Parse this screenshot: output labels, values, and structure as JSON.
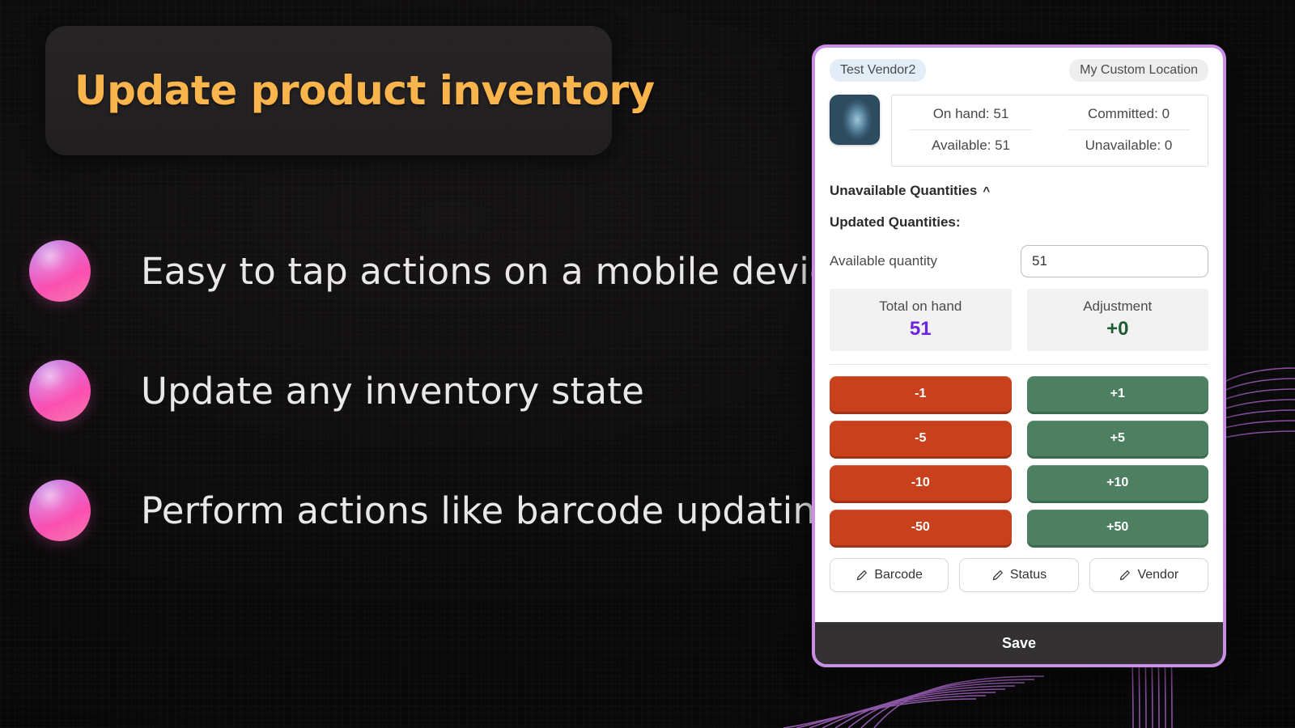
{
  "slide": {
    "title": "Update product inventory",
    "title_color": "#f9b44c",
    "bullets": [
      {
        "label": "Easy to tap actions on a mobile device",
        "marker": "gradient-sphere"
      },
      {
        "label": "Update any inventory state",
        "marker": "gradient-sphere"
      },
      {
        "label": "Perform actions like barcode updating",
        "marker": "gradient-sphere"
      }
    ]
  },
  "phone": {
    "frame_color": "#c98fe8",
    "vendor_pill": "Test Vendor2",
    "location_pill": "My Custom Location",
    "product_image": "decorated-egg-thumbnail",
    "stats": [
      {
        "label": "On hand: 51"
      },
      {
        "label": "Committed: 0"
      },
      {
        "label": "Available: 51"
      },
      {
        "label": "Unavailable: 0"
      }
    ],
    "unavailable_section": {
      "label": "Unavailable Quantities",
      "chevron": "˄"
    },
    "updated_quantities_heading": "Updated Quantities:",
    "available_quantity": {
      "label": "Available quantity",
      "value": "51",
      "placeholder": "0"
    },
    "totals": [
      {
        "caption": "Total on hand",
        "value": "51",
        "color": "#6a24e0"
      },
      {
        "caption": "Adjustment",
        "value": "+0",
        "color": "#1d5c33"
      }
    ],
    "adjust_buttons": [
      {
        "label": "-1",
        "kind": "minus",
        "color": "#c9401c"
      },
      {
        "label": "+1",
        "kind": "plus",
        "color": "#4c8060"
      },
      {
        "label": "-5",
        "kind": "minus",
        "color": "#c9401c"
      },
      {
        "label": "+5",
        "kind": "plus",
        "color": "#4c8060"
      },
      {
        "label": "-10",
        "kind": "minus",
        "color": "#c9401c"
      },
      {
        "label": "+10",
        "kind": "plus",
        "color": "#4c8060"
      },
      {
        "label": "-50",
        "kind": "minus",
        "color": "#c9401c"
      },
      {
        "label": "+50",
        "kind": "plus",
        "color": "#4c8060"
      }
    ],
    "edit_buttons": [
      {
        "label": "Barcode",
        "icon": "pencil-icon"
      },
      {
        "label": "Status",
        "icon": "pencil-icon"
      },
      {
        "label": "Vendor",
        "icon": "pencil-icon"
      }
    ],
    "save_label": "Save"
  }
}
